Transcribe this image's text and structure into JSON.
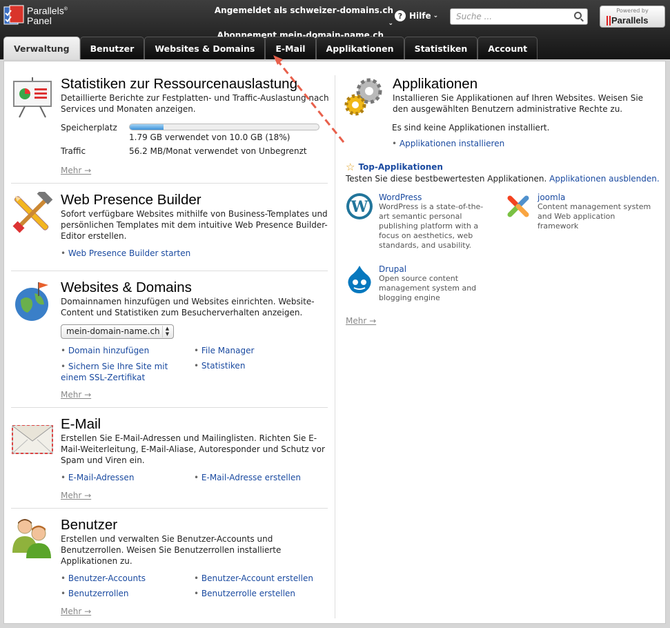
{
  "header": {
    "logo_line1": "Parallels",
    "logo_line2": "Panel",
    "logo_reg": "®",
    "logged_in_label": "Angemeldet als",
    "logged_in_user": "schweizer-domains.ch",
    "subscription_label": "Abonnement",
    "subscription_value": "mein-domain-name.ch",
    "help_label": "Hilfe",
    "search_placeholder": "Suche ...",
    "powered_by": "Powered by",
    "powered_brand": "Parallels"
  },
  "tabs": [
    {
      "label": "Verwaltung",
      "active": true
    },
    {
      "label": "Benutzer",
      "active": false
    },
    {
      "label": "Websites & Domains",
      "active": false
    },
    {
      "label": "E-Mail",
      "active": false
    },
    {
      "label": "Applikationen",
      "active": false
    },
    {
      "label": "Statistiken",
      "active": false
    },
    {
      "label": "Account",
      "active": false
    }
  ],
  "left": {
    "stats": {
      "title": "Statistiken zur Ressourcenauslastung",
      "desc": "Detaillierte Berichte zur Festplatten- und Traffic-Auslastung nach Services und Monaten anzeigen.",
      "storage_label": "Speicherplatz",
      "storage_value": "1.79 GB verwendet von 10.0 GB (18%)",
      "storage_fraction": 0.18,
      "traffic_label": "Traffic",
      "traffic_value": "56.2 MB/Monat verwendet von Unbegrenzt",
      "more": "Mehr →"
    },
    "wpb": {
      "title": "Web Presence Builder",
      "desc": "Sofort verfügbare Websites mithilfe von Business-Templates und persönlichen Templates mit dem intuitive Web Presence Builder-Editor erstellen.",
      "link": "Web Presence Builder starten"
    },
    "websites": {
      "title": "Websites & Domains",
      "desc": "Domainnamen hinzufügen und Websites einrichten. Website-Content und Statistiken zum Besucherverhalten anzeigen.",
      "selected_domain": "mein-domain-name.ch",
      "links": [
        "Domain hinzufügen",
        "File Manager",
        "Sichern Sie Ihre Site mit einem SSL-Zertifikat",
        "Statistiken"
      ],
      "more": "Mehr →"
    },
    "email": {
      "title": "E-Mail",
      "desc": "Erstellen Sie E-Mail-Adressen und Mailinglisten. Richten Sie E-Mail-Weiterleitung, E-Mail-Aliase, Autoresponder und Schutz vor Spam und Viren ein.",
      "links": [
        "E-Mail-Adressen",
        "E-Mail-Adresse erstellen"
      ],
      "more": "Mehr →"
    },
    "users": {
      "title": "Benutzer",
      "desc": "Erstellen und verwalten Sie Benutzer-Accounts und Benutzerrollen. Weisen Sie Benutzerrollen installierte Applikationen zu.",
      "links": [
        "Benutzer-Accounts",
        "Benutzer-Account erstellen",
        "Benutzerrollen",
        "Benutzerrolle erstellen"
      ],
      "more": "Mehr →"
    }
  },
  "right": {
    "title": "Applikationen",
    "desc": "Installieren Sie Applikationen auf Ihren Websites. Weisen Sie den ausgewählten Benutzern administrative Rechte zu.",
    "none_installed": "Es sind keine Applikationen installiert.",
    "install_link": "Applikationen installieren",
    "top_title": "Top-Applikationen",
    "top_desc": "Testen Sie diese bestbewertesten Applikationen.",
    "hide_link": "Applikationen ausblenden.",
    "apps": [
      {
        "name": "WordPress",
        "desc": "WordPress is a state-of-the-art semantic personal publishing platform with a focus on aesthetics, web standards, and usability."
      },
      {
        "name": "joomla",
        "desc": "Content management system and Web application framework"
      },
      {
        "name": "Drupal",
        "desc": "Open source content management system and blogging engine"
      }
    ],
    "more": "Mehr →"
  },
  "colors": {
    "link": "#1a4aa0",
    "annotation_arrow": "#e8604c",
    "progress": "#3c92d9"
  }
}
